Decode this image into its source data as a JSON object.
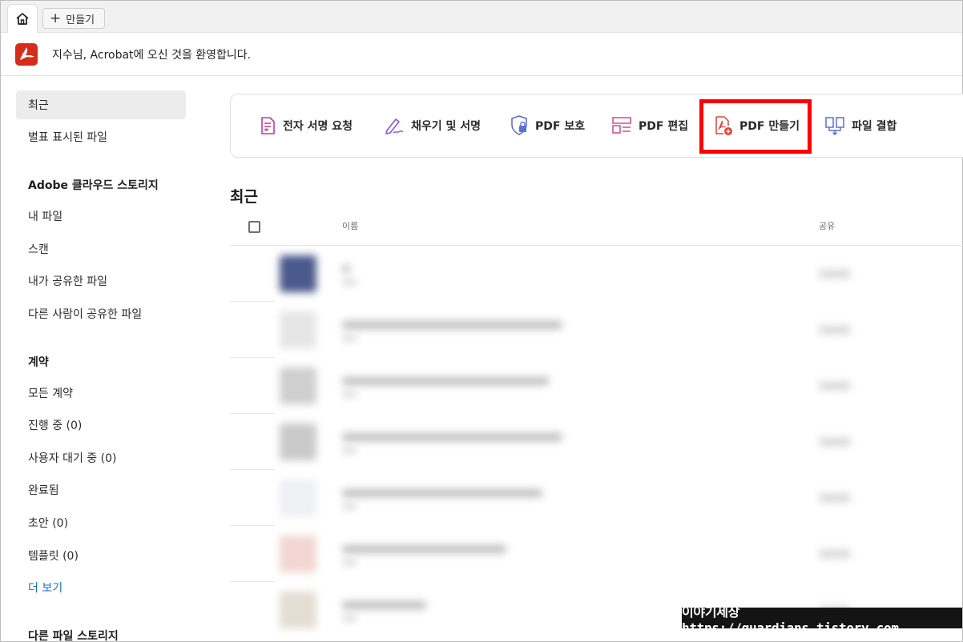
{
  "tabs": {
    "home_icon": "home-icon",
    "create_label": "만들기",
    "create_icon": "plus-icon"
  },
  "welcome": {
    "message": "지수님, Acrobat에 오신 것을 환영합니다."
  },
  "sidebar": {
    "recent": "최근",
    "starred": "별표 표시된 파일",
    "cloud_heading": "Adobe 클라우드 스토리지",
    "cloud_items": [
      "내 파일",
      "스캔",
      "내가 공유한 파일",
      "다른 사람이 공유한 파일"
    ],
    "agreements_heading": "계약",
    "agreement_items": [
      "모든 계약",
      "진행 중 (0)",
      "사용자 대기 중 (0)",
      "완료됨",
      "초안 (0)",
      "템플릿 (0)"
    ],
    "more_link": "더 보기",
    "other_storage_heading": "다른 파일 스토리지"
  },
  "tools": [
    {
      "label": "전자 서명 요청",
      "icon": "signature-request-icon",
      "color": "#c43a9a"
    },
    {
      "label": "채우기 및 서명",
      "icon": "fill-sign-icon",
      "color": "#8b55d9"
    },
    {
      "label": "PDF 보호",
      "icon": "shield-lock-icon",
      "color": "#5b6fd6"
    },
    {
      "label": "PDF 편집",
      "icon": "edit-pdf-icon",
      "color": "#d64a86"
    },
    {
      "label": "PDF 만들기",
      "icon": "create-pdf-icon",
      "color": "#e0443b"
    },
    {
      "label": "파일 결합",
      "icon": "combine-files-icon",
      "color": "#5b6fd6"
    }
  ],
  "recent": {
    "title": "최근",
    "columns": {
      "name": "이름",
      "share": "공유"
    }
  },
  "watermark": "이야기세상 https://guardians.tistory.com",
  "colors": {
    "brand_red": "#d52d1a",
    "highlight": "#ff0000",
    "link_blue": "#1a6dd6"
  }
}
